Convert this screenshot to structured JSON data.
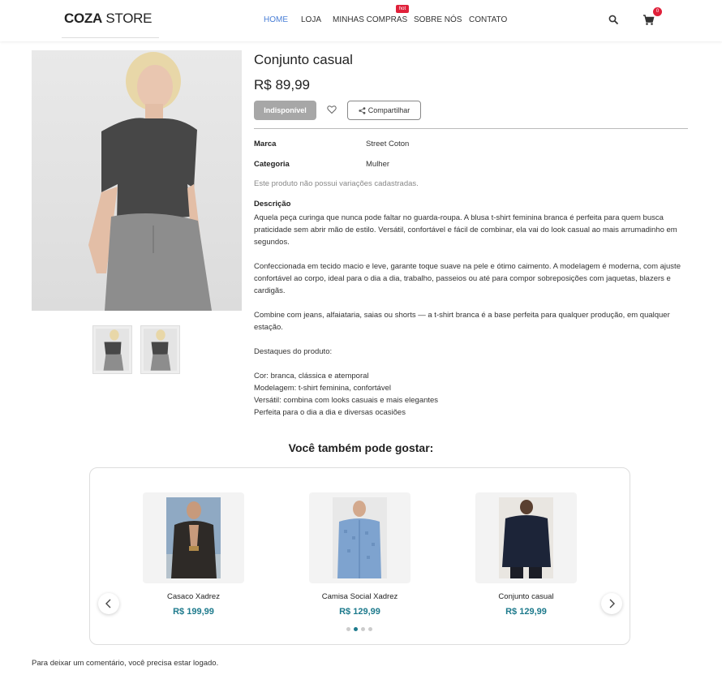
{
  "header": {
    "logo_bold": "COZA",
    "logo_light": " STORE",
    "nav": [
      "HOME",
      "LOJA",
      "MINHAS COMPRAS",
      "SOBRE NÓS",
      "CONTATO"
    ],
    "hot_badge": "hot",
    "cart_count": "0"
  },
  "product": {
    "title": "Conjunto casual",
    "price": "R$ 89,99",
    "unavailable_label": "Indisponível",
    "share_label": "Compartilhar",
    "brand_label": "Marca",
    "brand_value": "Street Coton",
    "category_label": "Categoria",
    "category_value": "Mulher",
    "no_variations": "Este produto não possui variações cadastradas.",
    "description_title": "Descrição",
    "description": [
      "Aquela peça curinga que nunca pode faltar no guarda-roupa. A blusa t-shirt feminina branca é perfeita para quem busca praticidade sem abrir mão de estilo. Versátil, confortável e fácil de combinar, ela vai do look casual ao mais arrumadinho em segundos.",
      "Confeccionada em tecido macio e leve, garante toque suave na pele e ótimo caimento. A modelagem é moderna, com ajuste confortável ao corpo, ideal para o dia a dia, trabalho, passeios ou até para compor sobreposições com jaquetas, blazers e cardigãs.",
      "Combine com jeans, alfaiataria, saias ou shorts — a t-shirt branca é a base perfeita para qualquer produção, em qualquer estação.",
      "Destaques do produto:"
    ],
    "highlights": [
      "Cor: branca, clássica e atemporal",
      "Modelagem: t-shirt feminina, confortável",
      "Versátil: combina com looks casuais e mais elegantes",
      "Perfeita para o dia a dia e diversas ocasiões"
    ]
  },
  "related": {
    "title": "Você também pode gostar:",
    "items": [
      {
        "name": "Casaco Xadrez",
        "price": "R$ 199,99"
      },
      {
        "name": "Camisa Social Xadrez",
        "price": "R$ 129,99"
      },
      {
        "name": "Conjunto casual",
        "price": "R$ 129,99"
      }
    ],
    "active_dot": 1,
    "dot_count": 4
  },
  "comment_note": "Para deixar um comentário, você precisa estar logado.",
  "colors": {
    "nav_active": "#4a7fd6",
    "badge": "#e0203a",
    "price_teal": "#1d7a8c",
    "unavailable_bg": "#a7a7a7"
  }
}
